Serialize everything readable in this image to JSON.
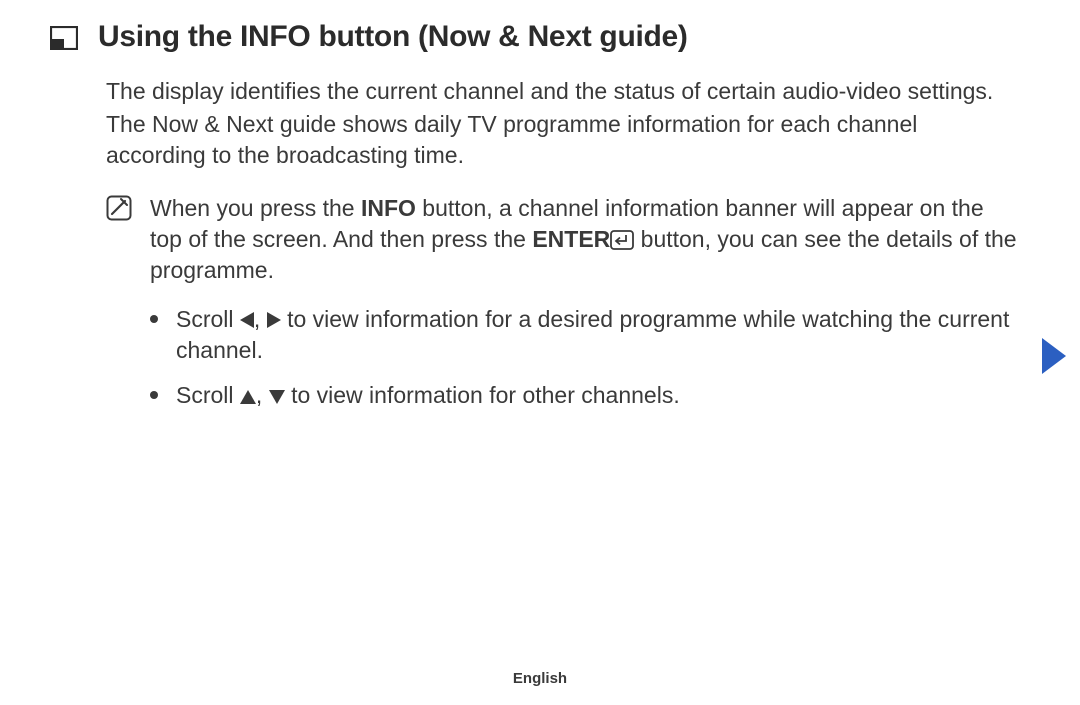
{
  "heading": "Using the INFO button (Now & Next guide)",
  "intro": {
    "p1": "The display identifies the current channel and the status of certain audio-video settings.",
    "p2": "The Now & Next guide shows daily TV programme information for each channel according to the broadcasting time."
  },
  "note": {
    "pre": "When you press the ",
    "bold1": "INFO",
    "mid1": " button, a channel information banner will appear on the top of the screen. And then press the ",
    "bold2": "ENTER",
    "post": " button, you can see the details of the programme."
  },
  "bullets": {
    "b1": {
      "pre": "Scroll ",
      "mid": " to view information for a desired programme while watching the current channel."
    },
    "b2": {
      "pre": "Scroll ",
      "mid": " to view information for other channels."
    }
  },
  "footer": "English"
}
